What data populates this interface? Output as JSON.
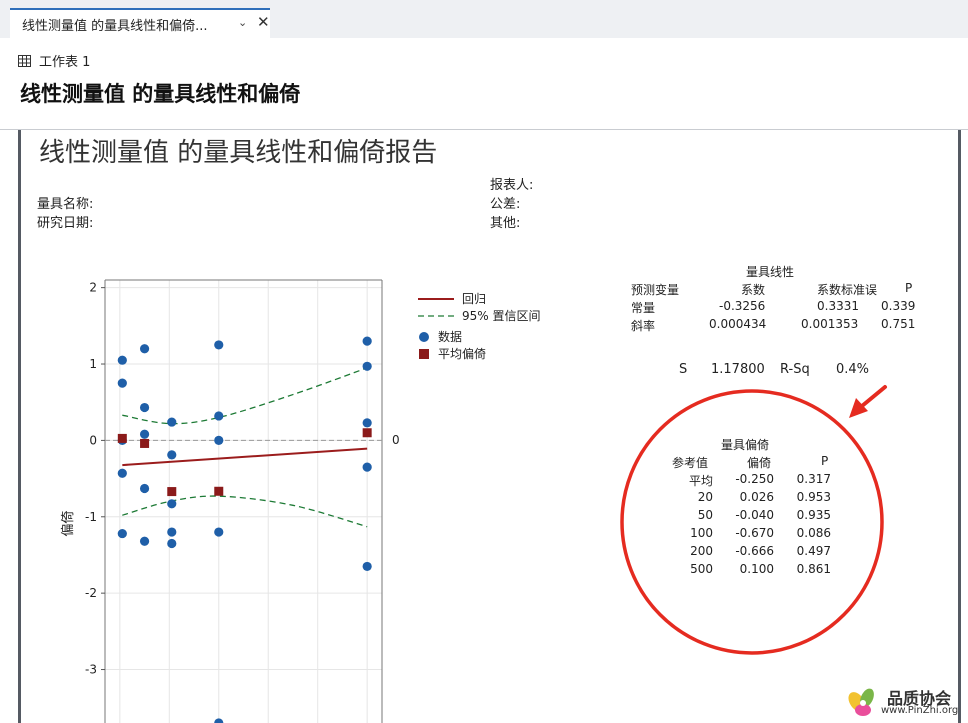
{
  "tab": {
    "title": "线性测量值 的量具线性和偏倚..."
  },
  "sheet": {
    "label": "工作表 1"
  },
  "page_title": "线性测量值 的量具线性和偏倚",
  "report": {
    "title": "线性测量值 的量具线性和偏倚报告",
    "reporter_label": "报表人:",
    "gage_name_label": "量具名称:",
    "tolerance_label": "公差:",
    "study_date_label": "研究日期:",
    "other_label": "其他:"
  },
  "legend": {
    "regression": "回归",
    "ci": "95% 置信区间",
    "data": "数据",
    "avg_bias": "平均偏倚"
  },
  "linearity": {
    "title": "量具线性",
    "headers": [
      "预测变量",
      "系数",
      "系数标准误",
      "P"
    ],
    "rows": [
      [
        "常量",
        "-0.3256",
        "0.3331",
        "0.339"
      ],
      [
        "斜率",
        "0.000434",
        "0.001353",
        "0.751"
      ]
    ],
    "s_label": "S",
    "s_value": "1.17800",
    "rsq_label": "R-Sq",
    "rsq_value": "0.4%"
  },
  "bias": {
    "title": "量具偏倚",
    "headers": [
      "参考值",
      "偏倚",
      "P"
    ],
    "rows": [
      [
        "平均",
        "-0.250",
        "0.317"
      ],
      [
        "20",
        "0.026",
        "0.953"
      ],
      [
        "50",
        "-0.040",
        "0.935"
      ],
      [
        "100",
        "-0.670",
        "0.086"
      ],
      [
        "200",
        "-0.666",
        "0.497"
      ],
      [
        "500",
        "0.100",
        "0.861"
      ]
    ]
  },
  "watermark": {
    "name": "品质协会",
    "url": "www.PinZhi.org"
  },
  "colors": {
    "regression": "#9b1c1c",
    "ci": "#1d7a35",
    "data": "#1f5fa8",
    "avg_bias": "#8b1a1a",
    "annotation": "#e52b20"
  },
  "chart_data": {
    "type": "scatter",
    "ylabel": "偏倚",
    "yticks": [
      "2",
      "1",
      "0",
      "-1",
      "-2",
      "-3"
    ],
    "ylim": [
      -3.7,
      2.1
    ],
    "xlim": [
      -30,
      530
    ],
    "ref_line_label": "0",
    "grid": true,
    "data_points": [
      {
        "x": 5,
        "y": 1.05
      },
      {
        "x": 5,
        "y": 0.75
      },
      {
        "x": 5,
        "y": 0.0
      },
      {
        "x": 5,
        "y": -0.43
      },
      {
        "x": 5,
        "y": -1.22
      },
      {
        "x": 50,
        "y": 1.2
      },
      {
        "x": 50,
        "y": 0.43
      },
      {
        "x": 50,
        "y": 0.08
      },
      {
        "x": 50,
        "y": -0.63
      },
      {
        "x": 50,
        "y": -1.32
      },
      {
        "x": 105,
        "y": 0.24
      },
      {
        "x": 105,
        "y": -0.19
      },
      {
        "x": 105,
        "y": -0.83
      },
      {
        "x": 105,
        "y": -1.2
      },
      {
        "x": 105,
        "y": -1.35
      },
      {
        "x": 200,
        "y": 1.25
      },
      {
        "x": 200,
        "y": 0.32
      },
      {
        "x": 200,
        "y": 0.0
      },
      {
        "x": 200,
        "y": -1.2
      },
      {
        "x": 200,
        "y": -3.7
      },
      {
        "x": 500,
        "y": 1.3
      },
      {
        "x": 500,
        "y": 0.97
      },
      {
        "x": 500,
        "y": 0.23
      },
      {
        "x": 500,
        "y": -0.35
      },
      {
        "x": 500,
        "y": -1.65
      }
    ],
    "avg_bias_points": [
      {
        "x": 5,
        "y": 0.026
      },
      {
        "x": 50,
        "y": -0.04
      },
      {
        "x": 105,
        "y": -0.67
      },
      {
        "x": 200,
        "y": -0.666
      },
      {
        "x": 500,
        "y": 0.1
      }
    ],
    "regression_line": [
      {
        "x": 5,
        "y": -0.323
      },
      {
        "x": 500,
        "y": -0.108
      }
    ],
    "ci_upper": [
      {
        "x": 5,
        "y": 0.33
      },
      {
        "x": 100,
        "y": 0.22
      },
      {
        "x": 200,
        "y": 0.3
      },
      {
        "x": 350,
        "y": 0.6
      },
      {
        "x": 500,
        "y": 0.95
      }
    ],
    "ci_lower": [
      {
        "x": 5,
        "y": -0.98
      },
      {
        "x": 100,
        "y": -0.8
      },
      {
        "x": 200,
        "y": -0.73
      },
      {
        "x": 350,
        "y": -0.85
      },
      {
        "x": 500,
        "y": -1.13
      }
    ]
  }
}
